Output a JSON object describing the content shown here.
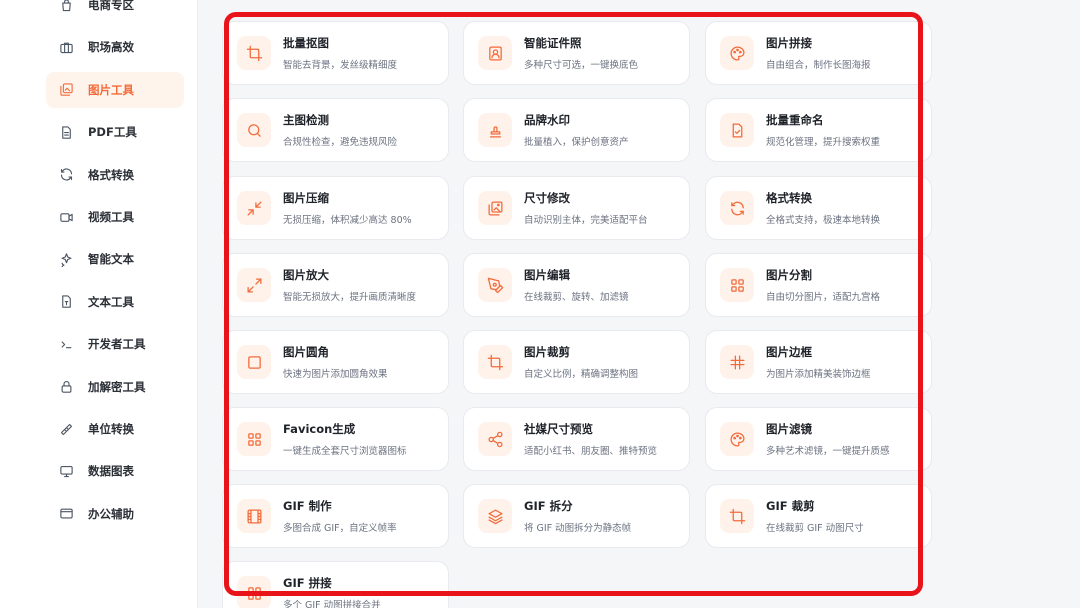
{
  "sidebar": {
    "items": [
      {
        "label": "电商专区",
        "icon": "shopping-bag-icon"
      },
      {
        "label": "职场高效",
        "icon": "briefcase-icon"
      },
      {
        "label": "图片工具",
        "icon": "image-stack-icon",
        "active": true
      },
      {
        "label": "PDF工具",
        "icon": "document-icon"
      },
      {
        "label": "格式转换",
        "icon": "refresh-icon"
      },
      {
        "label": "视频工具",
        "icon": "video-icon"
      },
      {
        "label": "智能文本",
        "icon": "sparkle-icon"
      },
      {
        "label": "文本工具",
        "icon": "text-file-icon"
      },
      {
        "label": "开发者工具",
        "icon": "terminal-icon"
      },
      {
        "label": "加解密工具",
        "icon": "lock-icon"
      },
      {
        "label": "单位转换",
        "icon": "ruler-icon"
      },
      {
        "label": "数据图表",
        "icon": "monitor-icon"
      },
      {
        "label": "办公辅助",
        "icon": "browser-window-icon"
      }
    ]
  },
  "tools": [
    {
      "title": "批量抠图",
      "desc": "智能去背景，发丝级精细度",
      "icon": "crop-icon"
    },
    {
      "title": "智能证件照",
      "desc": "多种尺寸可选，一键换底色",
      "icon": "id-photo-icon"
    },
    {
      "title": "图片拼接",
      "desc": "自由组合，制作长图海报",
      "icon": "palette-icon"
    },
    {
      "title": "主图检测",
      "desc": "合规性检查，避免违规风险",
      "icon": "search-icon"
    },
    {
      "title": "品牌水印",
      "desc": "批量植入，保护创意资产",
      "icon": "stamp-icon"
    },
    {
      "title": "批量重命名",
      "desc": "规范化管理，提升搜索权重",
      "icon": "file-check-icon"
    },
    {
      "title": "图片压缩",
      "desc": "无损压缩，体积减少高达 80%",
      "icon": "compress-icon"
    },
    {
      "title": "尺寸修改",
      "desc": "自动识别主体，完美适配平台",
      "icon": "images-icon"
    },
    {
      "title": "格式转换",
      "desc": "全格式支持，极速本地转换",
      "icon": "refresh-icon"
    },
    {
      "title": "图片放大",
      "desc": "智能无损放大，提升画质清晰度",
      "icon": "expand-icon"
    },
    {
      "title": "图片编辑",
      "desc": "在线裁剪、旋转、加滤镜",
      "icon": "pen-tool-icon"
    },
    {
      "title": "图片分割",
      "desc": "自由切分图片，适配九宫格",
      "icon": "grid-icon"
    },
    {
      "title": "图片圆角",
      "desc": "快速为图片添加圆角效果",
      "icon": "square-icon"
    },
    {
      "title": "图片裁剪",
      "desc": "自定义比例，精确调整构图",
      "icon": "crop-icon"
    },
    {
      "title": "图片边框",
      "desc": "为图片添加精美装饰边框",
      "icon": "hash-frame-icon"
    },
    {
      "title": "Favicon生成",
      "desc": "一键生成全套尺寸浏览器图标",
      "icon": "grid-icon"
    },
    {
      "title": "社媒尺寸预览",
      "desc": "适配小红书、朋友圈、推特预览",
      "icon": "share-icon"
    },
    {
      "title": "图片滤镜",
      "desc": "多种艺术滤镜，一键提升质感",
      "icon": "palette-icon"
    },
    {
      "title": "GIF 制作",
      "desc": "多图合成 GIF，自定义帧率",
      "icon": "film-icon"
    },
    {
      "title": "GIF 拆分",
      "desc": "将 GIF 动图拆分为静态帧",
      "icon": "layers-icon"
    },
    {
      "title": "GIF 裁剪",
      "desc": "在线裁剪 GIF 动图尺寸",
      "icon": "crop-icon"
    },
    {
      "title": "GIF 拼接",
      "desc": "多个 GIF 动图拼接合并",
      "icon": "grid-icon"
    }
  ],
  "colors": {
    "accent": "#f26b3a",
    "accent_bg": "#fff2ea",
    "highlight": "#e8141a"
  }
}
